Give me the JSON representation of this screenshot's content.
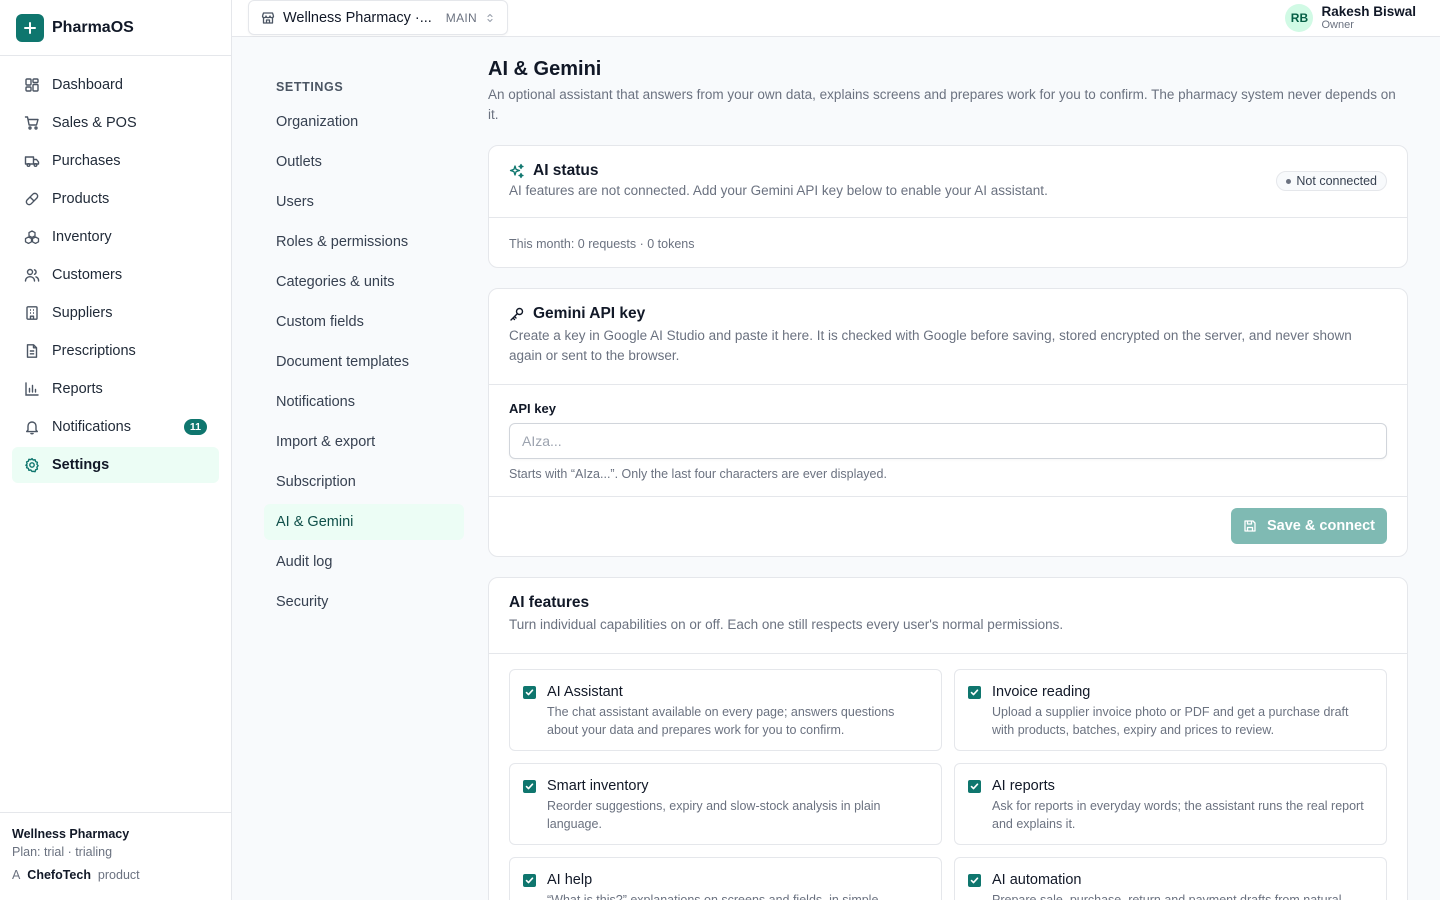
{
  "app": {
    "name": "PharmaOS"
  },
  "sidebar": {
    "items": [
      {
        "key": "dashboard",
        "label": "Dashboard",
        "icon": "dashboard-icon"
      },
      {
        "key": "sales",
        "label": "Sales & POS",
        "icon": "cart-icon"
      },
      {
        "key": "purchases",
        "label": "Purchases",
        "icon": "truck-icon"
      },
      {
        "key": "products",
        "label": "Products",
        "icon": "pill-icon"
      },
      {
        "key": "inventory",
        "label": "Inventory",
        "icon": "boxes-icon"
      },
      {
        "key": "customers",
        "label": "Customers",
        "icon": "users-icon"
      },
      {
        "key": "suppliers",
        "label": "Suppliers",
        "icon": "building-icon"
      },
      {
        "key": "prescriptions",
        "label": "Prescriptions",
        "icon": "document-icon"
      },
      {
        "key": "reports",
        "label": "Reports",
        "icon": "bar-chart-icon"
      },
      {
        "key": "notifications",
        "label": "Notifications",
        "icon": "bell-icon",
        "badge": "11"
      },
      {
        "key": "settings",
        "label": "Settings",
        "icon": "gear-icon",
        "active": true
      }
    ],
    "footer": {
      "org_name": "Wellness Pharmacy",
      "plan": "Plan: trial · trialing",
      "made_by_prefix": "A",
      "made_by_brand": "ChefoTech",
      "made_by_suffix": "product"
    }
  },
  "topbar": {
    "outlet_name": "Wellness Pharmacy ·...",
    "outlet_code": "MAIN",
    "user": {
      "initials": "RB",
      "name": "Rakesh Biswal",
      "role": "Owner"
    }
  },
  "settings_nav": {
    "heading": "SETTINGS",
    "items": [
      {
        "label": "Organization"
      },
      {
        "label": "Outlets"
      },
      {
        "label": "Users"
      },
      {
        "label": "Roles & permissions"
      },
      {
        "label": "Categories & units"
      },
      {
        "label": "Custom fields"
      },
      {
        "label": "Document templates"
      },
      {
        "label": "Notifications"
      },
      {
        "label": "Import & export"
      },
      {
        "label": "Subscription"
      },
      {
        "label": "AI & Gemini",
        "active": true
      },
      {
        "label": "Audit log"
      },
      {
        "label": "Security"
      }
    ]
  },
  "page": {
    "title": "AI & Gemini",
    "description": "An optional assistant that answers from your own data, explains screens and prepares work for you to confirm. The pharmacy system never depends on it."
  },
  "ai_status": {
    "title": "AI status",
    "subtitle": "AI features are not connected. Add your Gemini API key below to enable your AI assistant.",
    "status": "Not connected",
    "usage": "This month: 0 requests · 0 tokens"
  },
  "api_key": {
    "title": "Gemini API key",
    "subtitle": "Create a key in Google AI Studio and paste it here. It is checked with Google before saving, stored encrypted on the server, and never shown again or sent to the browser.",
    "label": "API key",
    "placeholder": "AIza...",
    "value": "",
    "hint": "Starts with “AIza...”. Only the last four characters are ever displayed.",
    "save_label": "Save & connect"
  },
  "features": {
    "title": "AI features",
    "subtitle": "Turn individual capabilities on or off. Each one still respects every user's normal permissions.",
    "items": [
      {
        "title": "AI Assistant",
        "desc": "The chat assistant available on every page; answers questions about your data and prepares work for you to confirm.",
        "checked": true
      },
      {
        "title": "Invoice reading",
        "desc": "Upload a supplier invoice photo or PDF and get a purchase draft with products, batches, expiry and prices to review.",
        "checked": true
      },
      {
        "title": "Smart inventory",
        "desc": "Reorder suggestions, expiry and slow-stock analysis in plain language.",
        "checked": true
      },
      {
        "title": "AI reports",
        "desc": "Ask for reports in everyday words; the assistant runs the real report and explains it.",
        "checked": true
      },
      {
        "title": "AI help",
        "desc": "“What is this?” explanations on screens and fields, in simple language.",
        "checked": true
      },
      {
        "title": "AI automation",
        "desc": "Prepare sale, purchase, return and payment drafts from natural language.",
        "checked": true
      }
    ]
  },
  "colors": {
    "accent": "#0f766e",
    "accent_soft": "#ecfdf5",
    "button_disabled": "#7fbab3"
  }
}
